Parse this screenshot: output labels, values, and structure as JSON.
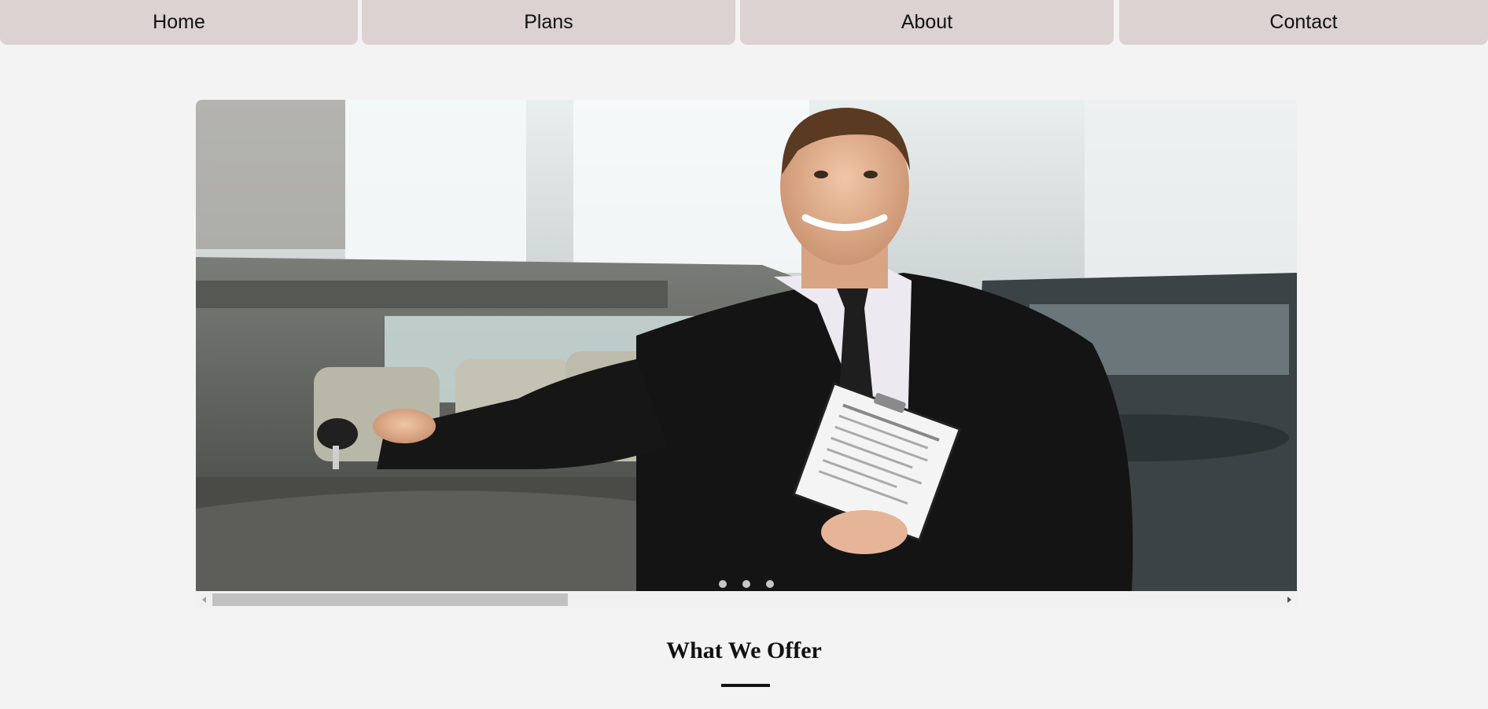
{
  "nav": {
    "items": [
      {
        "label": "Home"
      },
      {
        "label": "Plans"
      },
      {
        "label": "About"
      },
      {
        "label": "Contact"
      }
    ]
  },
  "carousel": {
    "image_description_icon": "car-salesman-photo",
    "active_slide": 1,
    "slide_count": 3,
    "scroll_position_fraction": 0.33
  },
  "section": {
    "title": "What We Offer"
  },
  "colors": {
    "nav_bg": "#dcd2d2",
    "page_bg": "#f3f3f3",
    "text": "#111111"
  }
}
